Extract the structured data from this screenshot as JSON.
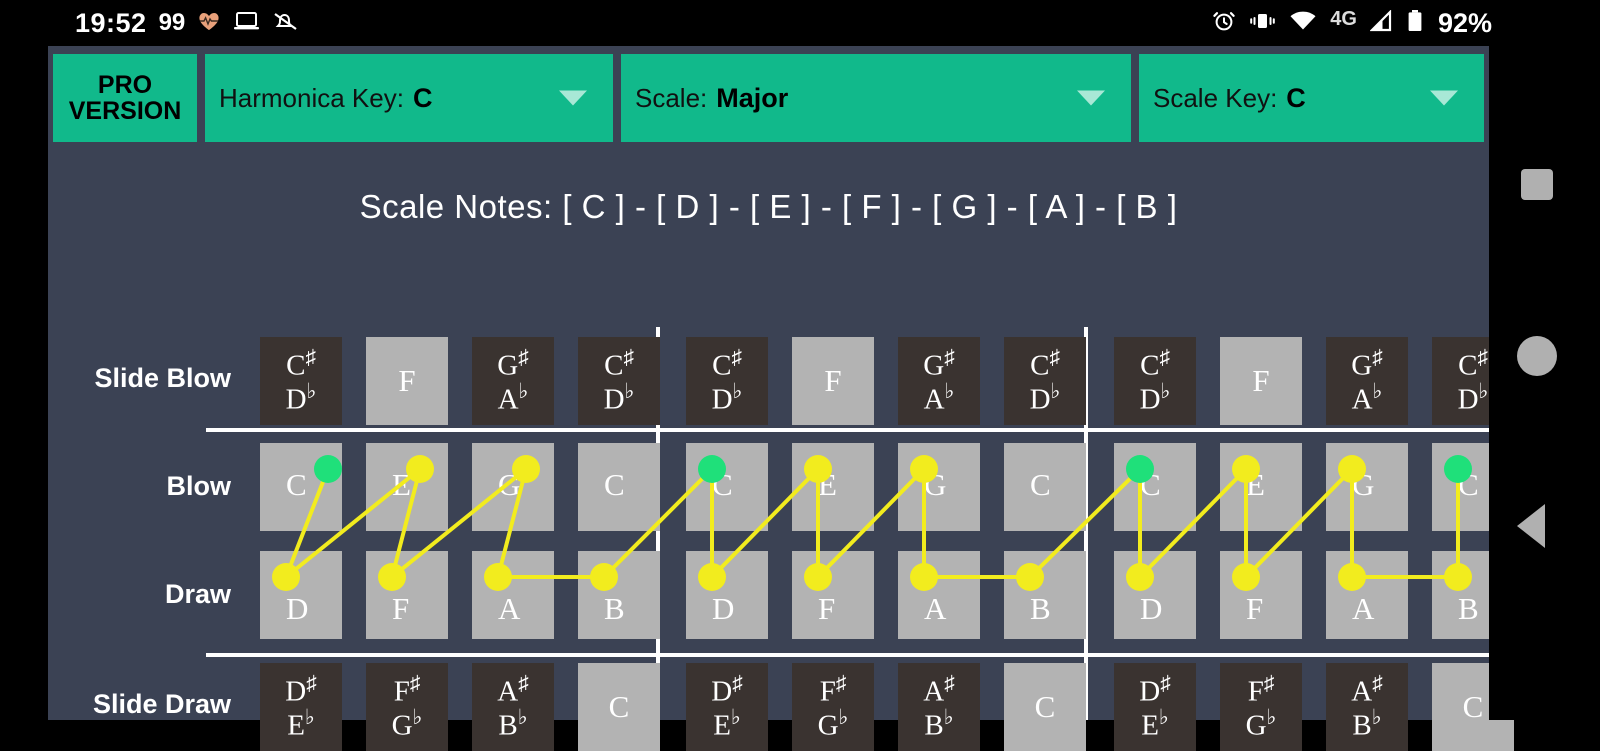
{
  "status_bar": {
    "time": "19:52",
    "badge_count": "99",
    "left_icons": [
      "heartbeat-icon",
      "laptop-icon",
      "bell-off-icon"
    ],
    "right_icons": [
      "alarm-icon",
      "vibrate-icon",
      "wifi-icon",
      "signal-icon"
    ],
    "network_label": "4G",
    "battery_percent": "92%"
  },
  "toolbar": {
    "pro_line1": "PRO",
    "pro_line2": "VERSION",
    "harmonica_key_label": "Harmonica Key:",
    "harmonica_key_value": "C",
    "scale_label": "Scale:",
    "scale_value": "Major",
    "scale_key_label": "Scale Key:",
    "scale_key_value": "C"
  },
  "scale_notes_text": "Scale Notes: [ C ] - [ D ] - [ E ] - [ F ] - [ G ] - [ A ] - [ B ]",
  "grid": {
    "row_labels": [
      "Slide Blow",
      "Blow",
      "Draw",
      "Slide Draw"
    ],
    "octaves": 3,
    "holes_per_octave": 4,
    "slide_blow": [
      {
        "sharp": "C#",
        "flat": "D♭",
        "single": null,
        "highlight": false
      },
      {
        "sharp": null,
        "flat": null,
        "single": "F",
        "highlight": true
      },
      {
        "sharp": "G#",
        "flat": "A♭",
        "single": null,
        "highlight": false
      },
      {
        "sharp": "C#",
        "flat": "D♭",
        "single": null,
        "highlight": false
      }
    ],
    "blow": [
      "C",
      "E",
      "G",
      "C"
    ],
    "draw": [
      "D",
      "F",
      "A",
      "B"
    ],
    "slide_draw": [
      {
        "sharp": "D#",
        "flat": "E♭",
        "single": null,
        "highlight": false
      },
      {
        "sharp": "F#",
        "flat": "G♭",
        "single": null,
        "highlight": false
      },
      {
        "sharp": "A#",
        "flat": "B♭",
        "single": null,
        "highlight": false
      },
      {
        "sharp": null,
        "flat": null,
        "single": "C",
        "highlight": true
      }
    ]
  },
  "colors": {
    "accent_green": "#11b98b",
    "background": "#3b4254",
    "dark_cell": "#3a3330",
    "light_cell": "#b3b3b3",
    "path_yellow": "#f2ec1e",
    "root_green": "#1fe07a",
    "separator": "#ffffff"
  },
  "path_markers": {
    "root_note": "C",
    "marker_color": "#f2ec1e",
    "root_marker_color": "#1fe07a",
    "sequence": [
      "C",
      "D",
      "E",
      "F",
      "G",
      "A",
      "B",
      "C",
      "D",
      "E",
      "F",
      "G",
      "A",
      "B",
      "C",
      "D",
      "E",
      "F",
      "G",
      "A",
      "B",
      "C"
    ]
  },
  "nav_bar": {
    "recents": "recents-square-icon",
    "home": "home-circle-icon",
    "back": "back-triangle-icon"
  }
}
